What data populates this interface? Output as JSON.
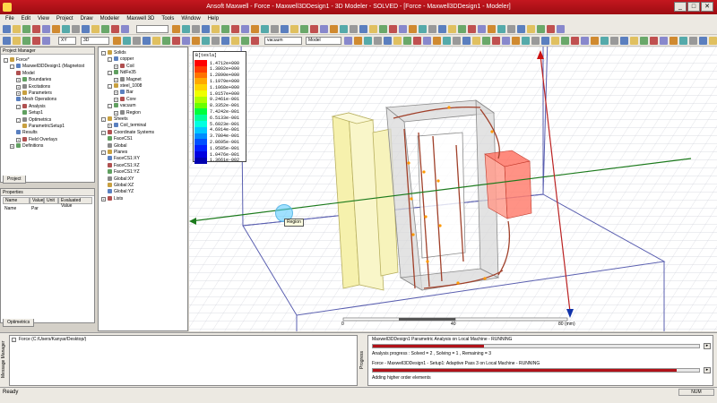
{
  "window": {
    "title": "Ansoft Maxwell - Force - Maxwell3DDesign1 - 3D Modeler - SOLVED - [Force - Maxwell3DDesign1 - Modeler]"
  },
  "menu": [
    "File",
    "Edit",
    "View",
    "Project",
    "Draw",
    "Modeler",
    "Maxwell 3D",
    "Tools",
    "Window",
    "Help"
  ],
  "toolbar": {
    "plane_combo": "XY",
    "dim_combo": "3D",
    "material_combo": "vacuum",
    "model_combo": "Model"
  },
  "project_manager": {
    "title": "Project Manager",
    "tab": "Project",
    "items": [
      {
        "label": "Force*",
        "depth": 0,
        "toggle": "-"
      },
      {
        "label": "Maxwell3DDesign1 (Magnetost",
        "depth": 1,
        "toggle": "-"
      },
      {
        "label": "Model",
        "depth": 2,
        "toggle": ""
      },
      {
        "label": "Boundaries",
        "depth": 2,
        "toggle": "+"
      },
      {
        "label": "Excitations",
        "depth": 2,
        "toggle": "+"
      },
      {
        "label": "Parameters",
        "depth": 2,
        "toggle": "+"
      },
      {
        "label": "Mesh Operations",
        "depth": 2,
        "toggle": ""
      },
      {
        "label": "Analysis",
        "depth": 2,
        "toggle": "-"
      },
      {
        "label": "Setup1",
        "depth": 3,
        "toggle": ""
      },
      {
        "label": "Optimetrics",
        "depth": 2,
        "toggle": "-"
      },
      {
        "label": "ParametricSetup1",
        "depth": 3,
        "toggle": ""
      },
      {
        "label": "Results",
        "depth": 2,
        "toggle": ""
      },
      {
        "label": "Field Overlays",
        "depth": 2,
        "toggle": "+"
      },
      {
        "label": "Definitions",
        "depth": 1,
        "toggle": "+"
      }
    ]
  },
  "properties": {
    "title": "Properties",
    "columns": [
      "Name",
      "Value",
      "Unit",
      "Evaluated Value"
    ],
    "row": [
      "Name",
      "Par",
      "",
      ""
    ],
    "tab": "Optimetrics"
  },
  "model_tree": {
    "items": [
      {
        "label": "Solids",
        "depth": 0,
        "toggle": "-"
      },
      {
        "label": "copper",
        "depth": 1,
        "toggle": "-"
      },
      {
        "label": "Coil",
        "depth": 2,
        "toggle": "+"
      },
      {
        "label": "NdFe35",
        "depth": 1,
        "toggle": "-"
      },
      {
        "label": "Magnet",
        "depth": 2,
        "toggle": "+"
      },
      {
        "label": "steel_1008",
        "depth": 1,
        "toggle": "-"
      },
      {
        "label": "Bar",
        "depth": 2,
        "toggle": "+"
      },
      {
        "label": "Core",
        "depth": 2,
        "toggle": "+"
      },
      {
        "label": "vacuum",
        "depth": 1,
        "toggle": "-"
      },
      {
        "label": "Region",
        "depth": 2,
        "toggle": "+"
      },
      {
        "label": "Sheets",
        "depth": 0,
        "toggle": "-"
      },
      {
        "label": "Coil_terminal",
        "depth": 1,
        "toggle": "+"
      },
      {
        "label": "Coordinate Systems",
        "depth": 0,
        "toggle": "-"
      },
      {
        "label": "FaceCS1",
        "depth": 1,
        "toggle": ""
      },
      {
        "label": "Global",
        "depth": 1,
        "toggle": ""
      },
      {
        "label": "Planes",
        "depth": 0,
        "toggle": "-"
      },
      {
        "label": "FaceCS1:XY",
        "depth": 1,
        "toggle": ""
      },
      {
        "label": "FaceCS1:XZ",
        "depth": 1,
        "toggle": ""
      },
      {
        "label": "FaceCS1:YZ",
        "depth": 1,
        "toggle": ""
      },
      {
        "label": "Global:XY",
        "depth": 1,
        "toggle": ""
      },
      {
        "label": "Global:XZ",
        "depth": 1,
        "toggle": ""
      },
      {
        "label": "Global:YZ",
        "depth": 1,
        "toggle": ""
      },
      {
        "label": "Lists",
        "depth": 0,
        "toggle": "+"
      }
    ]
  },
  "legend": {
    "title": "B[tesla]",
    "entries": [
      {
        "value": "1.4712e+000",
        "color": "#ff0000"
      },
      {
        "value": "1.3802e+000",
        "color": "#ff3a00"
      },
      {
        "value": "1.2890e+000",
        "color": "#ff7200"
      },
      {
        "value": "1.1979e+000",
        "color": "#ffa800"
      },
      {
        "value": "1.1068e+000",
        "color": "#ffd400"
      },
      {
        "value": "1.0157e+000",
        "color": "#f0ff00"
      },
      {
        "value": "9.2461e-001",
        "color": "#b0ff00"
      },
      {
        "value": "8.3352e-001",
        "color": "#6aff00"
      },
      {
        "value": "7.4242e-001",
        "color": "#00ff3c"
      },
      {
        "value": "6.5133e-001",
        "color": "#00ff9a"
      },
      {
        "value": "5.6023e-001",
        "color": "#00ffe0"
      },
      {
        "value": "4.6914e-001",
        "color": "#00c8ff"
      },
      {
        "value": "3.7804e-001",
        "color": "#008cff"
      },
      {
        "value": "2.8695e-001",
        "color": "#0050ff"
      },
      {
        "value": "1.9585e-001",
        "color": "#0020ff"
      },
      {
        "value": "1.0476e-001",
        "color": "#0000e0"
      },
      {
        "value": "1.3661e-002",
        "color": "#0000b0"
      }
    ]
  },
  "scale": {
    "ticks": [
      "0",
      "40",
      "80 (mm)"
    ]
  },
  "tooltip": "Region",
  "message_manager": {
    "label": "Message Manager",
    "item": "Force (C:/Users/Kanyar/Desktop/)"
  },
  "progress": {
    "label": "Progress",
    "task1_title": "Maxwell3DDesign1 Parametric Analysis on Local Machine - RUNNING",
    "task1_fill": 0.34,
    "task1_detail": "Analysis progress : Solved = 2 , Solving = 1 , Remaining = 3",
    "task2_title": "Force - Maxwell3DDesign1 - Setup1: Adaptive Pass 3 on Local Machine - RUNNING",
    "task2_fill": 0.93,
    "task2_detail": "Adding higher order elements"
  },
  "status": {
    "text": "Ready",
    "num": "NUM"
  },
  "colors": {
    "title_red": "#b11219",
    "coil": "#f4f0b0",
    "bar_red": "#ff8070"
  }
}
